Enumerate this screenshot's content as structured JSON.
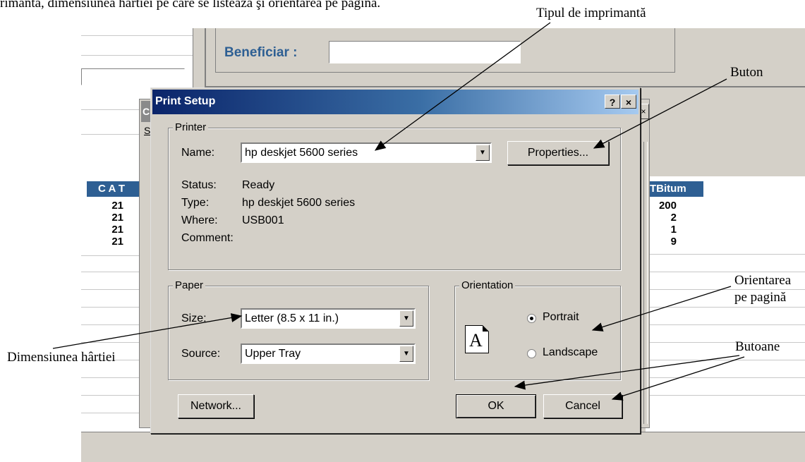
{
  "caption": {
    "top_text": "rimantă, dimensiunea hârtiei pe care se listează şi orientarea pe pagină.",
    "printer_type": "Tipul de imprimantă",
    "button": "Buton",
    "orientation_line1": "Orientarea",
    "orientation_line2": "pe pagină",
    "paper_size": "Dimensiunea hârtiei",
    "buttons": "Butoane"
  },
  "background_app": {
    "beneficiar_label": "Beneficiar :",
    "beneficiar_value": "",
    "col_left_header": "C A T",
    "col_right_header": "TBitum",
    "left_values": [
      "21",
      "21",
      "21",
      "21"
    ],
    "right_values": [
      "200",
      "2",
      "1",
      "9"
    ],
    "behind_title_char": "C",
    "behind_char": "S"
  },
  "dialog": {
    "title": "Print Setup",
    "help_button": "?",
    "close_button": "×",
    "printer_group": {
      "label": "Printer",
      "name_label": "Name:",
      "name_value": "hp deskjet 5600 series",
      "properties_button": "Properties...",
      "status_label": "Status:",
      "status_value": "Ready",
      "type_label": "Type:",
      "type_value": "hp deskjet 5600 series",
      "where_label": "Where:",
      "where_value": "USB001",
      "comment_label": "Comment:",
      "comment_value": ""
    },
    "paper_group": {
      "label": "Paper",
      "size_label": "Size:",
      "size_value": "Letter (8.5 x 11 in.)",
      "source_label": "Source:",
      "source_value": "Upper Tray"
    },
    "orientation_group": {
      "label": "Orientation",
      "icon_letter": "A",
      "portrait_label": "Portrait",
      "landscape_label": "Landscape",
      "selected": "Portrait"
    },
    "network_button": "Network...",
    "ok_button": "OK",
    "cancel_button": "Cancel"
  }
}
